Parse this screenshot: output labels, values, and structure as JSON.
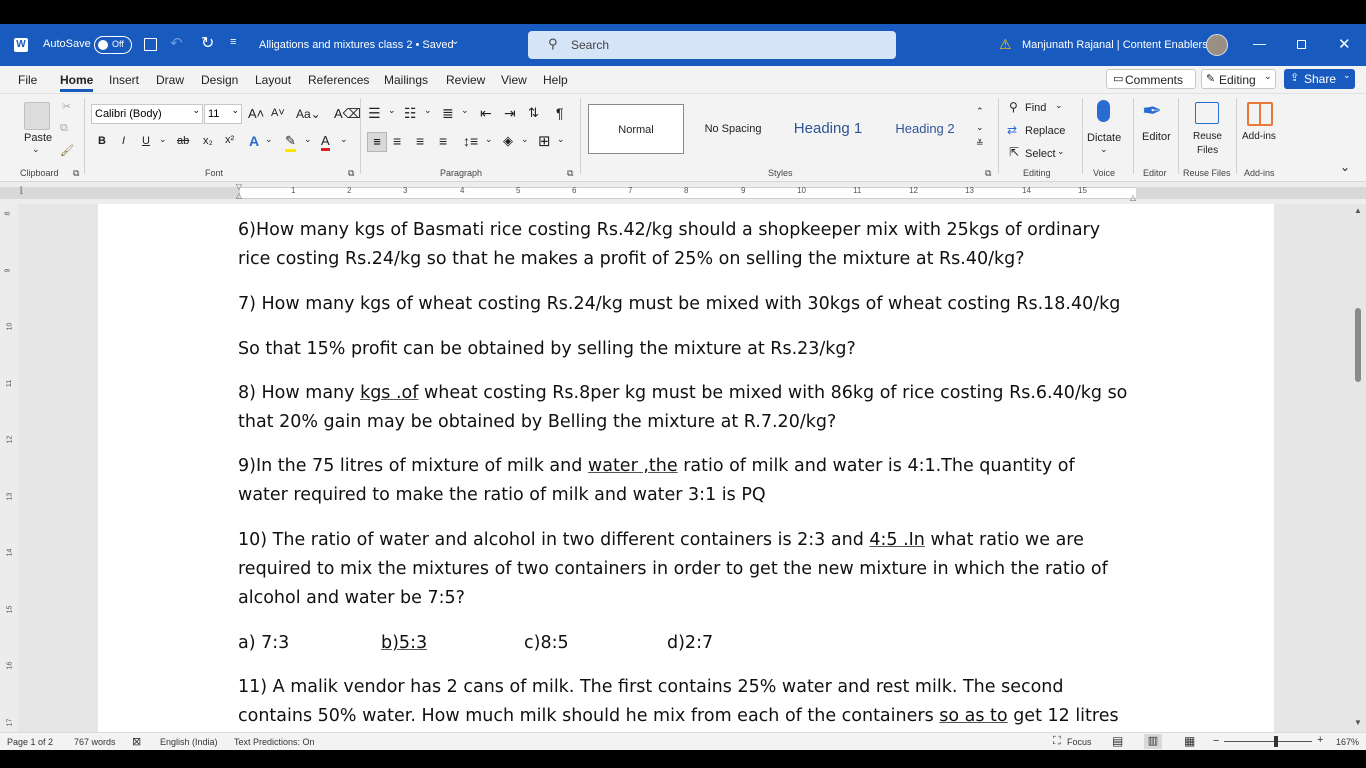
{
  "titlebar": {
    "autosave_label": "AutoSave",
    "autosave_state": "Off",
    "doc_title": "Alligations and mixtures class 2 • Saved",
    "search_placeholder": "Search",
    "user_name": "Manjunath Rajanal | Content Enablers"
  },
  "menu": {
    "items": [
      "File",
      "Home",
      "Insert",
      "Draw",
      "Design",
      "Layout",
      "References",
      "Mailings",
      "Review",
      "View",
      "Help"
    ],
    "comments_label": "Comments",
    "editing_label": "Editing",
    "share_label": "Share"
  },
  "ribbon": {
    "clipboard": {
      "paste_label": "Paste",
      "group_label": "Clipboard"
    },
    "font": {
      "font_name": "Calibri (Body)",
      "font_size": "11",
      "group_label": "Font"
    },
    "paragraph": {
      "group_label": "Paragraph"
    },
    "styles": {
      "items": [
        "Normal",
        "No Spacing",
        "Heading 1",
        "Heading 2"
      ],
      "group_label": "Styles"
    },
    "editing": {
      "find_label": "Find",
      "replace_label": "Replace",
      "select_label": "Select",
      "group_label": "Editing"
    },
    "voice": {
      "dictate_label": "Dictate",
      "group_label": "Voice"
    },
    "editor": {
      "editor_label": "Editor",
      "group_label": "Editor"
    },
    "reuse": {
      "label_line1": "Reuse",
      "label_line2": "Files",
      "group_label": "Reuse Files"
    },
    "addins": {
      "label": "Add-ins",
      "group_label": "Add-ins"
    }
  },
  "ruler": {
    "numbers": [
      "1",
      "2",
      "3",
      "4",
      "5",
      "6",
      "7",
      "8",
      "9",
      "10",
      "11",
      "12",
      "13",
      "14",
      "15"
    ]
  },
  "vruler": {
    "numbers": [
      "8",
      "9",
      "10",
      "11",
      "12",
      "13",
      "14",
      "15",
      "16",
      "17"
    ]
  },
  "document": {
    "q6_line1": "6)How many kgs of Basmati rice costing Rs.42/kg should a shopkeeper mix with 25kgs of ordinary",
    "q6_line2": "rice costing Rs.24/kg so that he makes a profit of 25% on selling the mixture at Rs.40/kg?",
    "q7_line1": "7) How many kgs of wheat costing Rs.24/kg must be mixed with 30kgs of wheat costing Rs.18.40/kg",
    "q7_line2": "So that 15% profit can be obtained by selling the mixture at Rs.23/kg?",
    "q8_a": "8) How many ",
    "q8_b": "kgs .of",
    "q8_c": " wheat costing Rs.8per kg must be mixed with 86kg  of rice costing Rs.6.40/kg so",
    "q8_line2": "that 20% gain may be obtained by Belling the mixture at R.7.20/kg?",
    "q9_a": "9)In the 75 litres of mixture of milk and ",
    "q9_b": "water ,the",
    "q9_c": " ratio of milk and water is 4:1.The quantity of",
    "q9_line2": "water required to make the ratio of milk and water 3:1 is PQ",
    "q10_a": "10) The ratio of water and alcohol in two different containers is 2:3 and ",
    "q10_b": "4:5 .In",
    "q10_c": " what ratio we are",
    "q10_line2": "required to mix the mixtures of two containers in order to get the new mixture in which the ratio of",
    "q10_line3": "alcohol and water be 7:5?",
    "opt_a": "a) 7:3",
    "opt_b": "b)5:3",
    "opt_c": "c)8:5",
    "opt_d": "d)2:7",
    "q11_line1": "11) A malik vendor has 2 cans of milk. The first contains 25% water and rest milk. The second",
    "q11_a": "contains 50% water. How much milk should he mix from each of the containers ",
    "q11_b": "so as to",
    "q11_c": " get 12 litres"
  },
  "status": {
    "page": "Page 1 of 2",
    "words": "767 words",
    "language": "English (India)",
    "predictions": "Text Predictions: On",
    "focus": "Focus",
    "zoom": "167%"
  }
}
